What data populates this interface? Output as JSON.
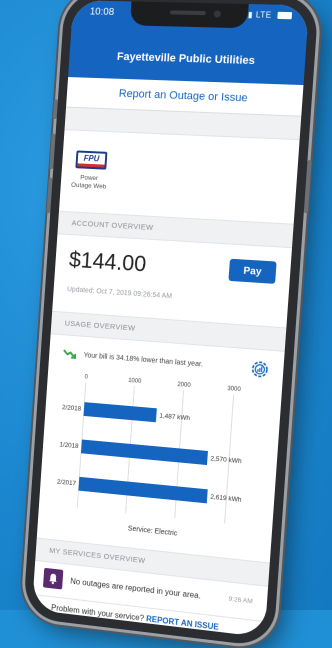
{
  "status_bar": {
    "time": "10:08",
    "network": "LTE"
  },
  "app": {
    "title": "Fayetteville Public Utilities"
  },
  "report_link": "Report an Outage or Issue",
  "logo": {
    "brand": "FPU",
    "label_line1": "Power",
    "label_line2": "Outage Web"
  },
  "account_overview": {
    "section_label": "ACCOUNT OVERVIEW",
    "amount": "$144.00",
    "pay_label": "Pay",
    "updated": "Updated: Oct 7, 2019 09:26:54 AM"
  },
  "usage_overview": {
    "section_label": "USAGE OVERVIEW",
    "trend_text": "Your bill is 34.18% lower than last year.",
    "service": "Service: Electric"
  },
  "chart_data": {
    "type": "bar",
    "orientation": "horizontal",
    "categories": [
      "2/2018",
      "1/2018",
      "2/2017"
    ],
    "values": [
      1487,
      2570,
      2619
    ],
    "value_labels": [
      "1,487 kWh",
      "2,570 kWh",
      "2,619 kWh"
    ],
    "ticks": [
      "0",
      "1000",
      "2000",
      "3000"
    ],
    "xlim": [
      0,
      3000
    ],
    "grid": true,
    "bar_color": "#1565c0"
  },
  "my_services": {
    "section_label": "MY SERVICES OVERVIEW",
    "message": "No outages are reported in your area.",
    "time": "9:26 AM"
  },
  "problem_bar": {
    "text": "Problem with your service?",
    "link": "REPORT AN ISSUE"
  },
  "colors": {
    "primary": "#1565c0",
    "accent_purple": "#5b2a6e",
    "trend_green": "#3aa84a"
  }
}
